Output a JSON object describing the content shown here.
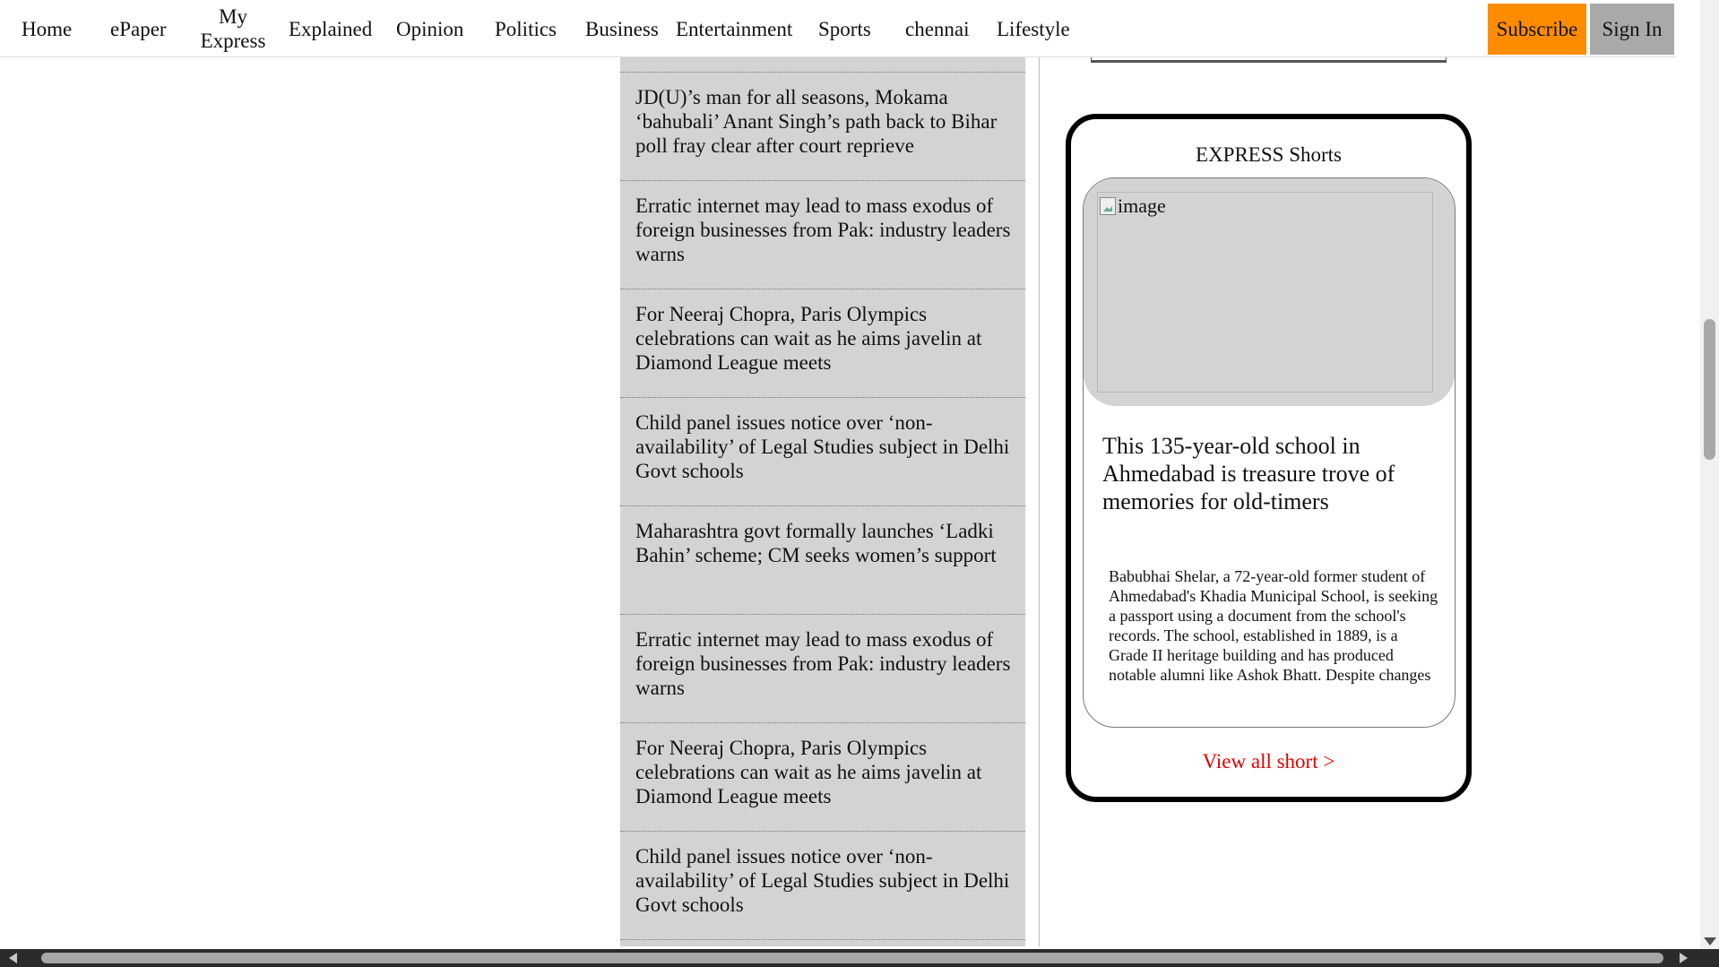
{
  "nav": {
    "items": [
      "Home",
      "ePaper",
      "My Express",
      "Explained",
      "Opinion",
      "Politics",
      "Business",
      "Entertainment",
      "Sports",
      "chennai",
      "Lifestyle"
    ],
    "subscribe": "Subscribe",
    "sign_in": "Sign In"
  },
  "news": {
    "items": [
      "JD(U)’s man for all seasons, Mokama ‘bahubali’ Anant Singh’s path back to Bihar poll fray clear after court reprieve",
      "Erratic internet may lead to mass exodus of foreign businesses from Pak: industry leaders warns",
      "For Neeraj Chopra, Paris Olympics celebrations can wait as he aims javelin at Diamond League meets",
      "Child panel issues notice over ‘non-availability’ of Legal Studies subject in Delhi Govt schools",
      "Maharashtra govt formally launches ‘Ladki Bahin’ scheme; CM seeks women’s support",
      "Erratic internet may lead to mass exodus of foreign businesses from Pak: industry leaders warns",
      "For Neeraj Chopra, Paris Olympics celebrations can wait as he aims javelin at Diamond League meets",
      "Child panel issues notice over ‘non-availability’ of Legal Studies subject in Delhi Govt schools"
    ]
  },
  "shorts": {
    "title": "EXPRESS Shorts",
    "image_alt": "image",
    "headline": "This 135-year-old school in Ahmedabad is treasure trove of memories for old-timers",
    "summary": "Babubhai Shelar, a 72-year-old former student of Ahmedabad's Khadia Municipal School, is seeking a passport using a document from the school's records. The school, established in 1889, is a Grade II heritage building and has produced notable alumni like Ashok Bhatt. Despite changes",
    "view_all": "View all short >"
  },
  "colors": {
    "subscribe_bg": "#ff8c00",
    "signin_bg": "#a9a9a9",
    "news_bg": "#d3d3d3",
    "link_red": "#e00000"
  }
}
